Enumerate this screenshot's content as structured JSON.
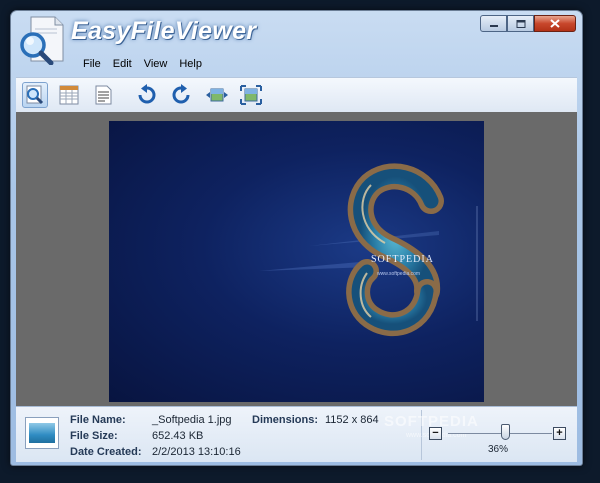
{
  "window": {
    "title": "EasyFileViewer",
    "buttons": {
      "minimize": "minimize",
      "maximize": "maximize",
      "close": "close"
    }
  },
  "menu": {
    "items": [
      "File",
      "Edit",
      "View",
      "Help"
    ]
  },
  "toolbar": {
    "buttons": [
      {
        "icon": "image-view-icon",
        "active": true
      },
      {
        "icon": "hex-grid-icon",
        "active": false
      },
      {
        "icon": "text-view-icon",
        "active": false
      },
      {
        "icon": "rotate-left-icon",
        "active": false
      },
      {
        "icon": "rotate-right-icon",
        "active": false
      },
      {
        "icon": "fit-width-icon",
        "active": false
      },
      {
        "icon": "fit-window-icon",
        "active": false
      }
    ]
  },
  "viewer": {
    "image_caption": "SOFTPEDIA",
    "image_url_text": "www.softpedia.com"
  },
  "status": {
    "file_name_label": "File Name:",
    "file_name": "_Softpedia 1.jpg",
    "file_size_label": "File Size:",
    "file_size": "652.43 KB",
    "date_created_label": "Date Created:",
    "date_created": "2/2/2013 13:10:16",
    "dimensions_label": "Dimensions:",
    "dimensions": "1152 x 864",
    "zoom_minus": "−",
    "zoom_plus": "+",
    "zoom_percent": "36%",
    "zoom_fraction": 0.36,
    "watermark": "SOFTPEDIA",
    "watermark_url": "www.softpedia.com"
  },
  "colors": {
    "title_text": "#ffffff",
    "viewer_bg": "#6a6a6a",
    "photo_bg": "#0e2260",
    "close_button": "#c8472c"
  }
}
